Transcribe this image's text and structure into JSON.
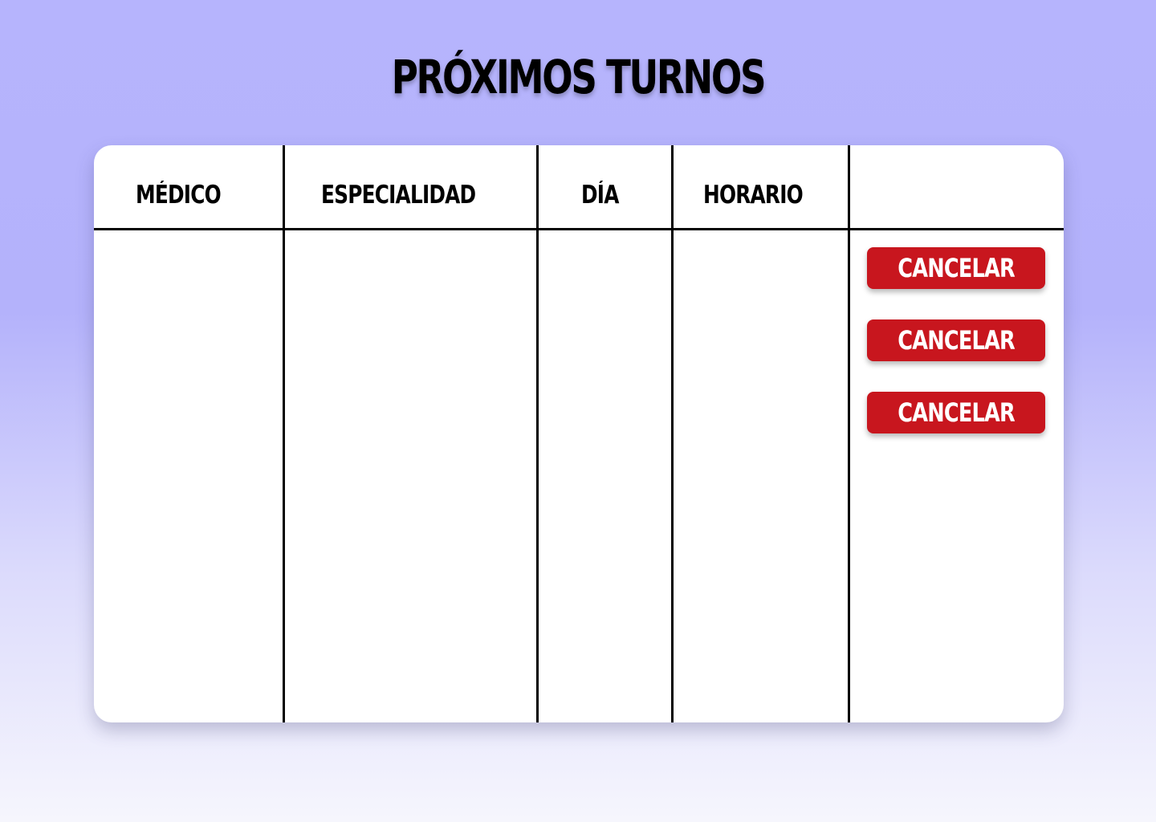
{
  "page": {
    "title": "PRÓXIMOS TURNOS"
  },
  "table": {
    "columns": [
      {
        "label": "MÉDICO"
      },
      {
        "label": "ESPECIALIDAD"
      },
      {
        "label": "DÍA"
      },
      {
        "label": "HORARIO"
      },
      {
        "label": ""
      }
    ],
    "rows": [
      {
        "medico": "",
        "especialidad": "",
        "dia": "",
        "horario": "",
        "action_label": "CANCELAR"
      },
      {
        "medico": "",
        "especialidad": "",
        "dia": "",
        "horario": "",
        "action_label": "CANCELAR"
      },
      {
        "medico": "",
        "especialidad": "",
        "dia": "",
        "horario": "",
        "action_label": "CANCELAR"
      }
    ]
  },
  "colors": {
    "background_top": "#b6b4fd",
    "background_bottom": "#f6f6fd",
    "cancel_button": "#c8161e",
    "grid_lines": "#000000"
  }
}
